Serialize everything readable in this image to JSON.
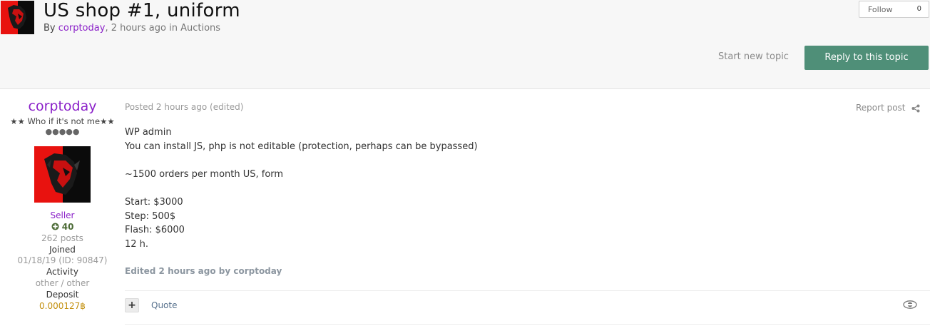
{
  "topic": {
    "title": "US shop #1, uniform",
    "by_label": "By",
    "author": "corptoday",
    "time": ", 2 hours ago in",
    "forum": "Auctions"
  },
  "follow": {
    "label": "Follow",
    "count": "0"
  },
  "actions": {
    "start_new_topic": "Start new topic",
    "reply": "Reply to this topic"
  },
  "author": {
    "name": "corptoday",
    "rank_title": "★★ Who if it's not me★★",
    "pips": "●●●●●",
    "group": "Seller",
    "reputation": "40",
    "posts": "262 posts",
    "joined_label": "Joined",
    "joined_value": "01/18/19 (ID: 90847)",
    "activity_label": "Activity",
    "activity_value": "other / other",
    "deposit_label": "Deposit",
    "deposit_value": "0.000127฿",
    "avatar_colors": {
      "left": "#e8120f",
      "right": "#0b0b0b"
    }
  },
  "post": {
    "date": "Posted 2 hours ago (edited)",
    "report": "Report post",
    "lines": [
      "WP admin",
      "You can install JS, php is not editable (protection, perhaps can be bypassed)",
      "",
      "~1500 orders per month US, form",
      "",
      "Start: $3000",
      "Step: 500$",
      "Flash: $6000",
      "12 h."
    ],
    "edited_note": "Edited 2 hours ago by corptoday",
    "quote": "Quote",
    "multiquote": "+"
  },
  "colors": {
    "accent_purple": "#8b21c9",
    "reply_button": "#4f8f78",
    "reputation": "#4c6b36",
    "deposit": "#c3900f"
  }
}
